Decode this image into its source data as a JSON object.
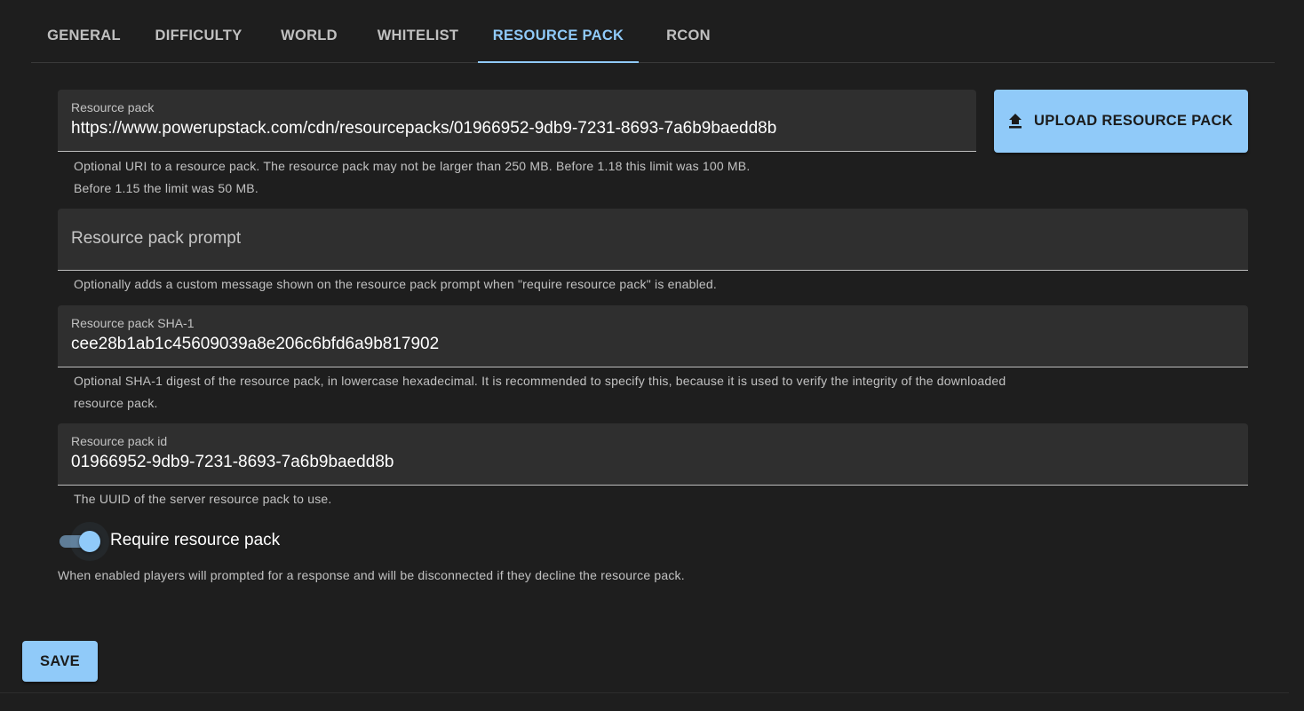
{
  "tabs": [
    {
      "label": "GENERAL",
      "active": false
    },
    {
      "label": "DIFFICULTY",
      "active": false
    },
    {
      "label": "WORLD",
      "active": false
    },
    {
      "label": "WHITELIST",
      "active": false
    },
    {
      "label": "RESOURCE PACK",
      "active": true
    },
    {
      "label": "RCON",
      "active": false
    }
  ],
  "fields": {
    "resource_pack": {
      "label": "Resource pack",
      "value": "https://www.powerupstack.com/cdn/resourcepacks/01966952-9db9-7231-8693-7a6b9baedd8b",
      "helper_line1": "Optional URI to a resource pack. The resource pack may not be larger than 250 MB. Before 1.18 this limit was 100 MB.",
      "helper_line2": "Before 1.15 the limit was 50 MB."
    },
    "resource_pack_prompt": {
      "placeholder": "Resource pack prompt",
      "value": "",
      "helper": "Optionally adds a custom message shown on the resource pack prompt when \"require resource pack\" is enabled."
    },
    "resource_pack_sha1": {
      "label": "Resource pack SHA-1",
      "value": "cee28b1ab1c45609039a8e206c6bfd6a9b817902",
      "helper_line1": "Optional SHA-1 digest of the resource pack, in lowercase hexadecimal. It is recommended to specify this, because it is used to verify the integrity of the downloaded",
      "helper_line2": "resource pack."
    },
    "resource_pack_id": {
      "label": "Resource pack id",
      "value": "01966952-9db9-7231-8693-7a6b9baedd8b",
      "helper": "The UUID of the server resource pack to use."
    }
  },
  "upload_button": {
    "label": "UPLOAD RESOURCE PACK",
    "icon": "upload-icon"
  },
  "require_resource_pack": {
    "label": "Require resource pack",
    "enabled": true,
    "helper": "When enabled players will prompted for a response and will be disconnected if they decline the resource pack."
  },
  "save_button": {
    "label": "SAVE"
  },
  "colors": {
    "accent": "#90caf9",
    "background": "#1e1e1e",
    "field_background": "#2f2f2f"
  }
}
